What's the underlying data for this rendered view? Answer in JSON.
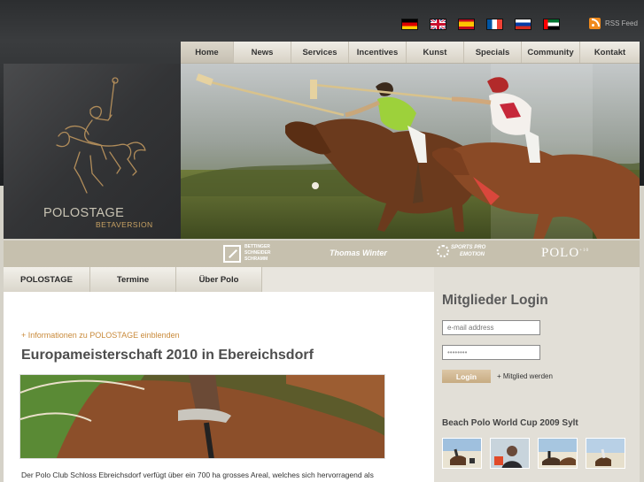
{
  "header": {
    "languages": [
      {
        "name": "Deutsch",
        "icon": "flag-de-icon"
      },
      {
        "name": "English",
        "icon": "flag-uk-icon"
      },
      {
        "name": "Español",
        "icon": "flag-es-icon"
      },
      {
        "name": "Français",
        "icon": "flag-fr-icon"
      },
      {
        "name": "Русский",
        "icon": "flag-ru-icon"
      },
      {
        "name": "العربية",
        "icon": "flag-ae-icon"
      }
    ],
    "rss_label": "RSS Feed"
  },
  "nav": {
    "items": [
      {
        "label": "Home",
        "active": true
      },
      {
        "label": "News"
      },
      {
        "label": "Services"
      },
      {
        "label": "Incentives"
      },
      {
        "label": "Kunst"
      },
      {
        "label": "Specials"
      },
      {
        "label": "Community"
      },
      {
        "label": "Kontakt"
      }
    ]
  },
  "logo": {
    "name": "POLOSTAGE",
    "tagline": "BETAVERSION"
  },
  "sponsors": {
    "bettinger_lines": [
      "BETTINGER",
      "SCHNEIDER",
      "SCHRAMM"
    ],
    "thomas_winter": "Thomas Winter",
    "sports_pro_lines": [
      "SPORTS PRO",
      "EMOTION"
    ],
    "polo": "POLO",
    "polo_sup": "+10"
  },
  "subtabs": [
    "POLOSTAGE",
    "Termine",
    "Über Polo"
  ],
  "article": {
    "info_link": "+ Informationen zu POLOSTAGE einblenden",
    "headline": "Europameisterschaft 2010 in Ebereichsdorf",
    "teaser": "Der Polo Club Schloss Ebreichsdorf verfügt über ein 700 ha grosses Areal, welches sich hervorragend als"
  },
  "login": {
    "title": "Mitglieder Login",
    "email_placeholder": "e-mail address",
    "password_value": "••••••••",
    "button_label": "Login",
    "register_label": "+ Mitglied werden"
  },
  "gallery": {
    "title": "Beach Polo World Cup 2009 Sylt",
    "thumb_count": 4
  },
  "colors": {
    "accent": "#c98a3a",
    "nav_bg": "#e3dfd5",
    "sidebar_bg": "#e2dfd7",
    "sponsor_bar": "#c6c0ae",
    "logo_gold": "#c8a263"
  }
}
